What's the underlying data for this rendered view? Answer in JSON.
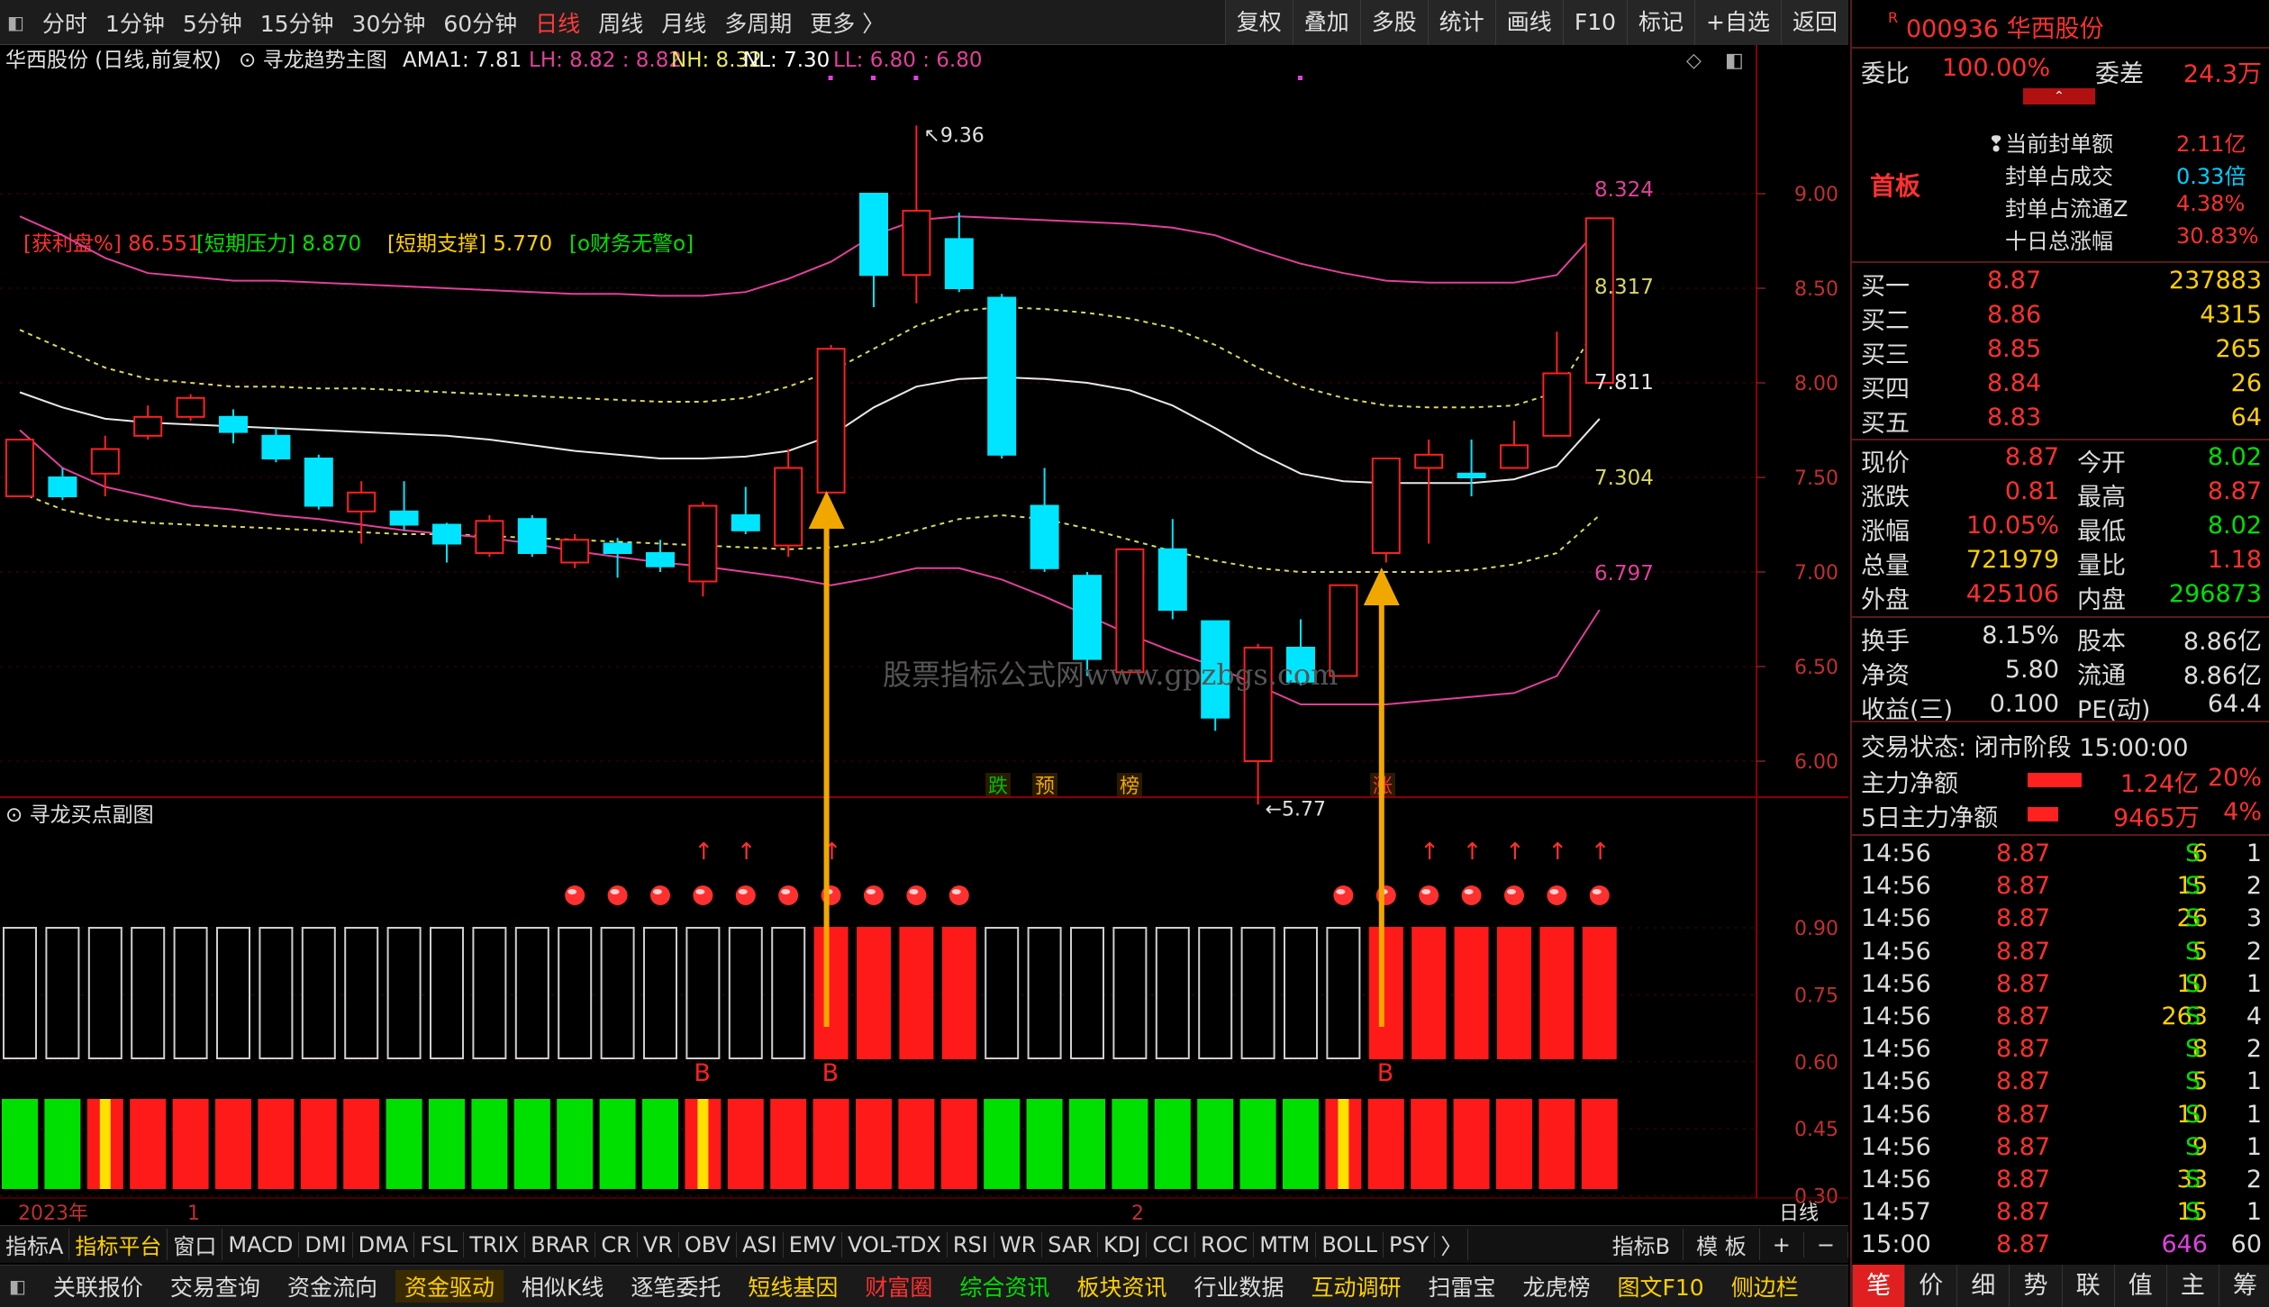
{
  "toolbar": {
    "periods": [
      "分时",
      "1分钟",
      "5分钟",
      "15分钟",
      "30分钟",
      "60分钟",
      "日线",
      "周线",
      "月线",
      "多周期",
      "更多 〉"
    ],
    "active_period": "日线",
    "buttons": [
      "复权",
      "叠加",
      "多股",
      "统计",
      "画线",
      "F10",
      "标记",
      "+自选",
      "返回"
    ]
  },
  "main_chart": {
    "title": "华西股份 (日线,前复权)",
    "indicator_name": "寻龙趋势主图",
    "ama_label": "AMA1: 7.81",
    "lh_label": "LH: 8.82 : 8.82",
    "nh_label": "NH: 8.32",
    "nl_label": "NL: 7.30",
    "ll_label": "LL: 6.80 : 6.80",
    "info_profit": "[获利盘%] 86.551",
    "info_pressure": "[短期压力] 8.870",
    "info_support": "[短期支撑] 5.770",
    "info_finance": "[o财务无警o]",
    "price_ticks": [
      "9.00",
      "8.50",
      "8.00",
      "7.50",
      "7.00",
      "6.50",
      "6.00"
    ],
    "high_note": "9.36",
    "low_note": "5.77",
    "band_labels": [
      "8.324",
      "8.317",
      "7.811",
      "7.304",
      "6.797"
    ],
    "event_tags": [
      "跌",
      "预",
      "榜",
      "涨"
    ],
    "watermark": "股票指标公式网www.gpzbgs.com"
  },
  "chart_data": {
    "type": "candlestick",
    "candles": [
      {
        "o": 7.4,
        "c": 7.7,
        "h": 7.7,
        "l": 7.4
      },
      {
        "o": 7.5,
        "c": 7.4,
        "h": 7.55,
        "l": 7.38
      },
      {
        "o": 7.52,
        "c": 7.65,
        "h": 7.72,
        "l": 7.4
      },
      {
        "o": 7.72,
        "c": 7.82,
        "h": 7.88,
        "l": 7.7
      },
      {
        "o": 7.82,
        "c": 7.92,
        "h": 7.94,
        "l": 7.8
      },
      {
        "o": 7.82,
        "c": 7.74,
        "h": 7.86,
        "l": 7.68
      },
      {
        "o": 7.72,
        "c": 7.6,
        "h": 7.76,
        "l": 7.58
      },
      {
        "o": 7.6,
        "c": 7.35,
        "h": 7.62,
        "l": 7.33
      },
      {
        "o": 7.32,
        "c": 7.42,
        "h": 7.48,
        "l": 7.15
      },
      {
        "o": 7.32,
        "c": 7.25,
        "h": 7.48,
        "l": 7.22
      },
      {
        "o": 7.25,
        "c": 7.15,
        "h": 7.26,
        "l": 7.05
      },
      {
        "o": 7.1,
        "c": 7.27,
        "h": 7.3,
        "l": 7.08
      },
      {
        "o": 7.28,
        "c": 7.1,
        "h": 7.3,
        "l": 7.08
      },
      {
        "o": 7.05,
        "c": 7.17,
        "h": 7.2,
        "l": 7.02
      },
      {
        "o": 7.15,
        "c": 7.1,
        "h": 7.18,
        "l": 6.97
      },
      {
        "o": 7.1,
        "c": 7.03,
        "h": 7.17,
        "l": 7.0
      },
      {
        "o": 6.95,
        "c": 7.35,
        "h": 7.37,
        "l": 6.87
      },
      {
        "o": 7.3,
        "c": 7.22,
        "h": 7.45,
        "l": 7.2
      },
      {
        "o": 7.14,
        "c": 7.55,
        "h": 7.65,
        "l": 7.08
      },
      {
        "o": 7.42,
        "c": 8.18,
        "h": 8.2,
        "l": 7.42
      },
      {
        "o": 9.0,
        "c": 8.57,
        "h": 9.0,
        "l": 8.4
      },
      {
        "o": 8.57,
        "c": 8.91,
        "h": 9.36,
        "l": 8.42
      },
      {
        "o": 8.76,
        "c": 8.5,
        "h": 8.9,
        "l": 8.48
      },
      {
        "o": 8.45,
        "c": 7.62,
        "h": 8.47,
        "l": 7.6
      },
      {
        "o": 7.35,
        "c": 7.02,
        "h": 7.55,
        "l": 7.0
      },
      {
        "o": 6.98,
        "c": 6.54,
        "h": 7.0,
        "l": 6.45
      },
      {
        "o": 6.47,
        "c": 7.12,
        "h": 7.12,
        "l": 6.47
      },
      {
        "o": 7.12,
        "c": 6.8,
        "h": 7.28,
        "l": 6.75
      },
      {
        "o": 6.74,
        "c": 6.23,
        "h": 6.74,
        "l": 6.16
      },
      {
        "o": 6.0,
        "c": 6.6,
        "h": 6.62,
        "l": 5.77
      },
      {
        "o": 6.6,
        "c": 6.42,
        "h": 6.75,
        "l": 6.4
      },
      {
        "o": 6.45,
        "c": 6.93,
        "h": 6.93,
        "l": 6.45
      },
      {
        "o": 7.1,
        "c": 7.6,
        "h": 7.6,
        "l": 7.05
      },
      {
        "o": 7.55,
        "c": 7.62,
        "h": 7.7,
        "l": 7.15
      },
      {
        "o": 7.52,
        "c": 7.5,
        "h": 7.7,
        "l": 7.4
      },
      {
        "o": 7.55,
        "c": 7.67,
        "h": 7.8,
        "l": 7.55
      },
      {
        "o": 7.72,
        "c": 8.05,
        "h": 8.27,
        "l": 7.72
      },
      {
        "o": 8.0,
        "c": 8.87,
        "h": 8.87,
        "l": 8.02
      }
    ],
    "bands": {
      "upper": [
        8.88,
        8.78,
        8.66,
        8.58,
        8.56,
        8.54,
        8.54,
        8.53,
        8.52,
        8.51,
        8.5,
        8.49,
        8.48,
        8.47,
        8.47,
        8.46,
        8.46,
        8.48,
        8.55,
        8.64,
        8.78,
        8.86,
        8.88,
        8.87,
        8.86,
        8.85,
        8.84,
        8.82,
        8.78,
        8.7,
        8.63,
        8.58,
        8.54,
        8.53,
        8.53,
        8.53,
        8.57,
        8.82
      ],
      "upper_mid": [
        8.28,
        8.18,
        8.08,
        8.02,
        8.0,
        7.98,
        7.98,
        7.97,
        7.97,
        7.96,
        7.95,
        7.94,
        7.93,
        7.92,
        7.91,
        7.9,
        7.9,
        7.92,
        7.98,
        8.06,
        8.18,
        8.3,
        8.38,
        8.4,
        8.39,
        8.37,
        8.34,
        8.29,
        8.2,
        8.08,
        7.98,
        7.92,
        7.88,
        7.87,
        7.87,
        7.88,
        7.95,
        8.32
      ],
      "mid": [
        7.95,
        7.87,
        7.81,
        7.79,
        7.78,
        7.77,
        7.76,
        7.75,
        7.74,
        7.73,
        7.72,
        7.7,
        7.67,
        7.64,
        7.62,
        7.6,
        7.6,
        7.61,
        7.64,
        7.72,
        7.87,
        7.98,
        8.02,
        8.03,
        8.02,
        8.0,
        7.96,
        7.88,
        7.76,
        7.63,
        7.52,
        7.48,
        7.47,
        7.47,
        7.47,
        7.49,
        7.56,
        7.81
      ],
      "lower_mid": [
        7.42,
        7.33,
        7.28,
        7.26,
        7.25,
        7.24,
        7.23,
        7.22,
        7.21,
        7.2,
        7.2,
        7.19,
        7.18,
        7.17,
        7.16,
        7.15,
        7.14,
        7.13,
        7.12,
        7.13,
        7.16,
        7.22,
        7.28,
        7.3,
        7.28,
        7.23,
        7.17,
        7.11,
        7.06,
        7.02,
        7.0,
        7.0,
        7.0,
        7.0,
        7.01,
        7.04,
        7.1,
        7.3
      ],
      "lower": [
        7.75,
        7.55,
        7.45,
        7.4,
        7.35,
        7.33,
        7.3,
        7.28,
        7.25,
        7.22,
        7.2,
        7.18,
        7.15,
        7.11,
        7.08,
        7.05,
        7.03,
        7.0,
        6.97,
        6.93,
        6.97,
        7.02,
        7.02,
        6.96,
        6.87,
        6.77,
        6.67,
        6.58,
        6.5,
        6.4,
        6.3,
        6.3,
        6.3,
        6.32,
        6.34,
        6.36,
        6.45,
        6.8
      ]
    },
    "ylim": [
      5.6,
      9.55
    ]
  },
  "sub_chart": {
    "title": "寻龙买点副图",
    "ticks": [
      "0.90",
      "0.75",
      "0.60",
      "0.45",
      "0.30"
    ],
    "bars": [
      0,
      0,
      0,
      0,
      0,
      0,
      0,
      0,
      0,
      0,
      0,
      0,
      0,
      0,
      0,
      0,
      0,
      0,
      0,
      1,
      1,
      1,
      1,
      0,
      0,
      0,
      0,
      0,
      0,
      0,
      0,
      0,
      1,
      1,
      1,
      1,
      1,
      1
    ],
    "dots": [
      0,
      0,
      0,
      0,
      0,
      0,
      0,
      0,
      0,
      0,
      0,
      0,
      0,
      1,
      1,
      1,
      1,
      1,
      1,
      1,
      1,
      1,
      1,
      0,
      0,
      0,
      0,
      0,
      0,
      0,
      0,
      1,
      1,
      1,
      1,
      1,
      1,
      1
    ],
    "up_arrows": [
      0,
      0,
      0,
      0,
      0,
      0,
      0,
      0,
      0,
      0,
      0,
      0,
      0,
      0,
      0,
      0,
      1,
      1,
      0,
      1,
      0,
      0,
      0,
      0,
      0,
      0,
      0,
      0,
      0,
      0,
      0,
      0,
      0,
      1,
      1,
      1,
      1,
      1
    ],
    "b_marks": [
      16,
      19,
      32
    ],
    "b_label": "B",
    "strip": [
      "g",
      "g",
      "y",
      "r",
      "r",
      "r",
      "r",
      "r",
      "r",
      "g",
      "g",
      "g",
      "g",
      "g",
      "g",
      "g",
      "y",
      "r",
      "r",
      "r",
      "r",
      "r",
      "r",
      "g",
      "g",
      "g",
      "g",
      "g",
      "g",
      "g",
      "g",
      "y",
      "r",
      "r",
      "r",
      "r",
      "r",
      "r"
    ],
    "year_label": "2023年",
    "month_labels": [
      "1",
      "2"
    ],
    "period_label": "日线"
  },
  "indicator_tabs": [
    "指标A",
    "指标平台",
    "窗口",
    "MACD",
    "DMI",
    "DMA",
    "FSL",
    "TRIX",
    "BRAR",
    "CR",
    "VR",
    "OBV",
    "ASI",
    "EMV",
    "VOL-TDX",
    "RSI",
    "WR",
    "SAR",
    "KDJ",
    "CCI",
    "ROC",
    "MTM",
    "BOLL",
    "PSY",
    "〉"
  ],
  "indicator_right": [
    "指标B",
    "模 板",
    "+",
    "−"
  ],
  "function_tabs": [
    "关联报价",
    "交易查询",
    "资金流向",
    "资金驱动",
    "相似K线",
    "逐笔委托",
    "短线基因",
    "财富圈",
    "综合资讯",
    "板块资讯",
    "行业数据",
    "互动调研",
    "扫雷宝",
    "龙虎榜",
    "图文F10",
    "侧边栏"
  ],
  "quote": {
    "code_name": "000936 华西股份",
    "weibi_label": "委比",
    "weibi": "100.00%",
    "weicha_label": "委差",
    "weicha": "24.3万",
    "board": "首板",
    "seal_items": [
      {
        "label": "当前封单额",
        "value": "2.11亿"
      },
      {
        "label": "封单占成交",
        "value": "0.33倍"
      },
      {
        "label": "封单占流通Z",
        "value": "4.38%"
      },
      {
        "label": "十日总涨幅",
        "value": "30.83%"
      }
    ],
    "bids": [
      {
        "label": "买一",
        "price": "8.87",
        "vol": "237883"
      },
      {
        "label": "买二",
        "price": "8.86",
        "vol": "4315"
      },
      {
        "label": "买三",
        "price": "8.85",
        "vol": "265"
      },
      {
        "label": "买四",
        "price": "8.84",
        "vol": "26"
      },
      {
        "label": "买五",
        "price": "8.83",
        "vol": "64"
      }
    ],
    "stats": [
      {
        "l1": "现价",
        "v1": "8.87",
        "l2": "今开",
        "v2": "8.02"
      },
      {
        "l1": "涨跌",
        "v1": "0.81",
        "l2": "最高",
        "v2": "8.87"
      },
      {
        "l1": "涨幅",
        "v1": "10.05%",
        "l2": "最低",
        "v2": "8.02"
      },
      {
        "l1": "总量",
        "v1": "721979",
        "l2": "量比",
        "v2": "1.18"
      },
      {
        "l1": "外盘",
        "v1": "425106",
        "l2": "内盘",
        "v2": "296873"
      }
    ],
    "stats2": [
      {
        "l1": "换手",
        "v1": "8.15%",
        "l2": "股本",
        "v2": "8.86亿"
      },
      {
        "l1": "净资",
        "v1": "5.80",
        "l2": "流通",
        "v2": "8.86亿"
      },
      {
        "l1": "收益(三)",
        "v1": "0.100",
        "l2": "PE(动)",
        "v2": "64.4"
      }
    ],
    "trade_status": "交易状态: 闭市阶段 15:00:00",
    "main_net_label": "主力净额",
    "main_net": "1.24亿",
    "main_net_pct": "20%",
    "five_net_label": "5日主力净额",
    "five_net": "9465万",
    "five_net_pct": "4%",
    "ticks": [
      {
        "t": "14:56",
        "p": "8.87",
        "v": "6",
        "s": "S",
        "n": "1"
      },
      {
        "t": "14:56",
        "p": "8.87",
        "v": "15",
        "s": "S",
        "n": "2"
      },
      {
        "t": "14:56",
        "p": "8.87",
        "v": "26",
        "s": "S",
        "n": "3"
      },
      {
        "t": "14:56",
        "p": "8.87",
        "v": "5",
        "s": "S",
        "n": "2"
      },
      {
        "t": "14:56",
        "p": "8.87",
        "v": "10",
        "s": "S",
        "n": "1"
      },
      {
        "t": "14:56",
        "p": "8.87",
        "v": "263",
        "s": "S",
        "n": "4"
      },
      {
        "t": "14:56",
        "p": "8.87",
        "v": "8",
        "s": "S",
        "n": "2"
      },
      {
        "t": "14:56",
        "p": "8.87",
        "v": "5",
        "s": "S",
        "n": "1"
      },
      {
        "t": "14:56",
        "p": "8.87",
        "v": "10",
        "s": "S",
        "n": "1"
      },
      {
        "t": "14:56",
        "p": "8.87",
        "v": "9",
        "s": "S",
        "n": "1"
      },
      {
        "t": "14:56",
        "p": "8.87",
        "v": "33",
        "s": "S",
        "n": "2"
      },
      {
        "t": "14:57",
        "p": "8.87",
        "v": "15",
        "s": "S",
        "n": "1"
      },
      {
        "t": "15:00",
        "p": "8.87",
        "v": "646",
        "s": "",
        "n": "60"
      }
    ],
    "bottom_tabs": [
      "笔",
      "价",
      "细",
      "势",
      "联",
      "值",
      "主",
      "筹"
    ]
  },
  "colors": {
    "up": "#ff2020",
    "down": "#00e5ff",
    "green": "#00e000",
    "yellow": "#ffd000",
    "magenta": "#e0409a",
    "orange": "#f0a800"
  }
}
